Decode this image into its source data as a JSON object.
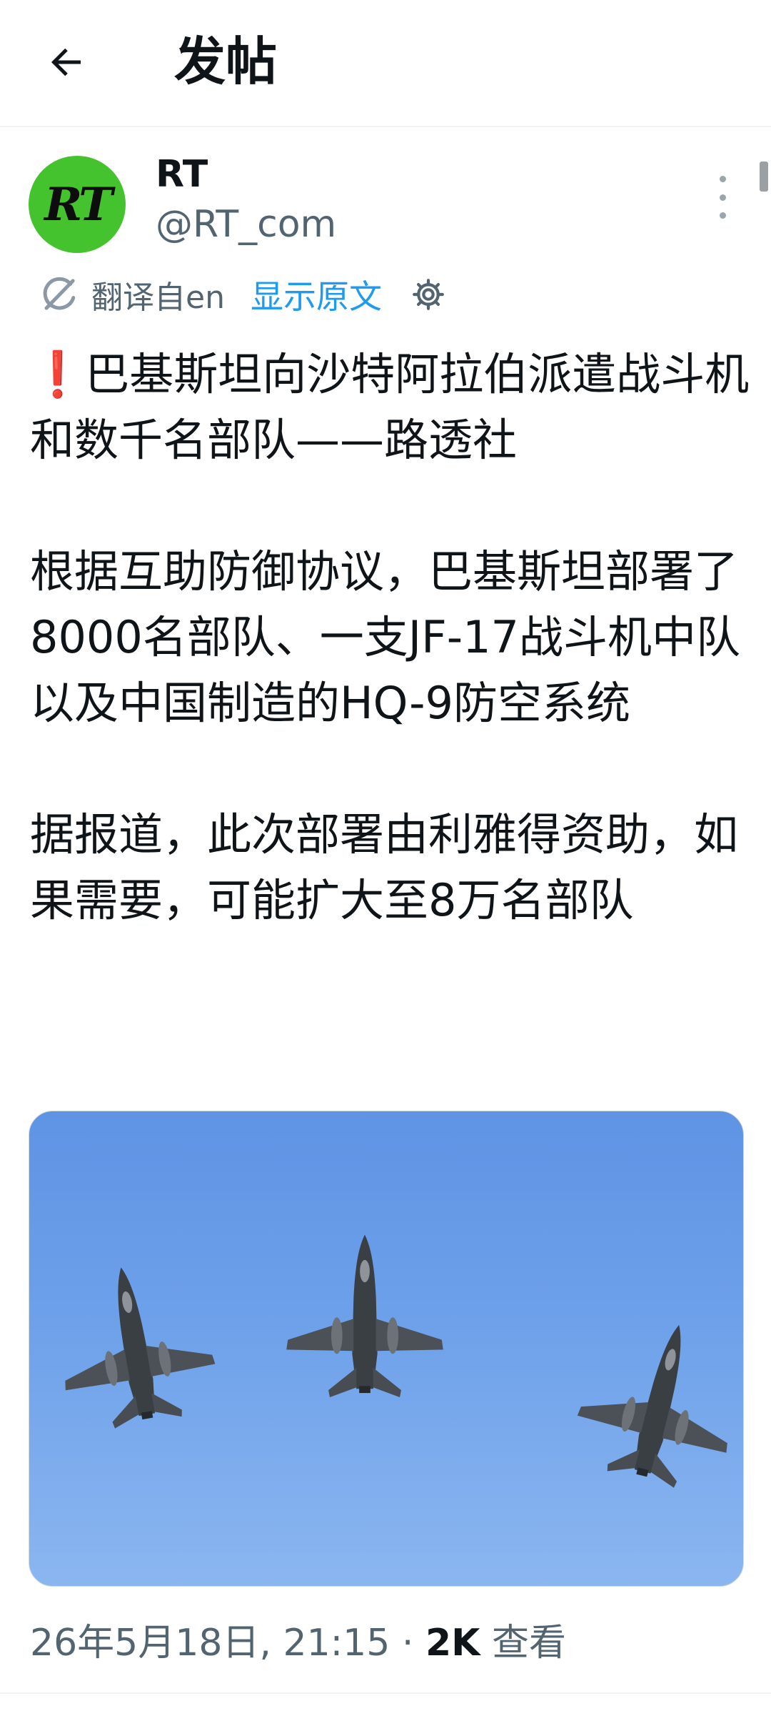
{
  "header": {
    "title": "发帖"
  },
  "author": {
    "name": "RT",
    "handle": "@RT_com",
    "avatar_text": "RT"
  },
  "translation": {
    "from_label": "翻译自en",
    "show_original_label": "显示原文"
  },
  "post": {
    "line1_icon": "❗",
    "line1": "巴基斯坦向沙特阿拉伯派遣战斗机和数千名部队——路透社",
    "para2": "根据互助防御协议，巴基斯坦部署了8000名部队、一支JF-17战斗机中队以及中国制造的HQ-9防空系统",
    "para3": "据报道，此次部署由利雅得资助，如果需要，可能扩大至8万名部队"
  },
  "meta": {
    "timestamp": "26年5月18日, 21:15",
    "separator": "·",
    "views_count": "2K",
    "views_label": "查看"
  },
  "colors": {
    "accent": "#1d9bf0",
    "avatar_bg": "#45c32f",
    "sky": "#6ea1ea",
    "secondary_text": "#536471"
  },
  "icons": [
    "back-arrow-icon",
    "more-vertical-icon",
    "translate-icon",
    "gear-icon"
  ]
}
